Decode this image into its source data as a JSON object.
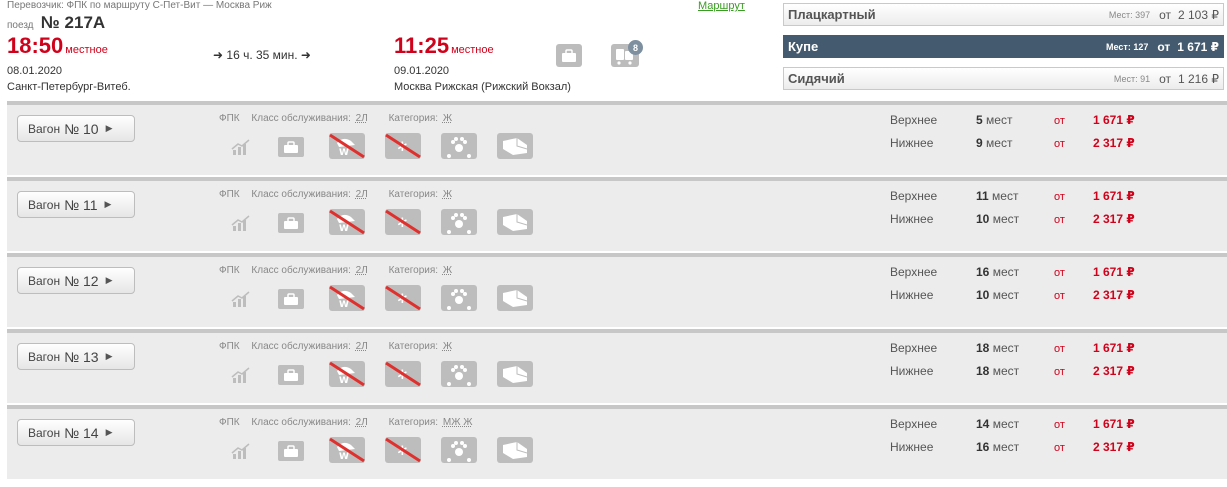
{
  "header": {
    "carrier_text": "Перевозчик: ФПК   по маршруту С-Пет-Вит — Москва Риж",
    "route_link": "Маршрут",
    "train_prefix": "поезд",
    "train_number": "№ 217А",
    "departure": {
      "time": "18:50",
      "local_label": "местное",
      "date": "08.01.2020",
      "station": "Санкт-Петербург-Витеб."
    },
    "duration": "➜ 16 ч. 35 мин. ➜",
    "arrival": {
      "time": "11:25",
      "local_label": "местное",
      "date": "09.01.2020",
      "station": "Москва Рижская (Рижский Вокзал)"
    },
    "icons": [
      "luggage-icon",
      "baggage-cart-icon"
    ],
    "baggage_badge": "8"
  },
  "classes": [
    {
      "name": "Плацкартный",
      "seats": "Мест: 397",
      "from": "от",
      "price": "2 103 ₽",
      "active": false
    },
    {
      "name": "Купе",
      "seats": "Мест: 127",
      "from": "от",
      "price": "1 671 ₽",
      "active": true
    },
    {
      "name": "Сидячий",
      "seats": "Мест: 91",
      "from": "от",
      "price": "1 216 ₽",
      "active": false
    }
  ],
  "wagon_common": {
    "label": "Вагон",
    "carrier": "ФПК",
    "service_label": "Класс обслуживания:",
    "service_class": "2Л",
    "category_label": "Категория:",
    "from": "от",
    "upper_label": "Верхнее",
    "lower_label": "Нижнее",
    "seats_unit": "мест"
  },
  "wagons": [
    {
      "number": "№ 10",
      "category": "Ж",
      "upper_count": "5",
      "upper_price": "1 671 ₽",
      "lower_count": "9",
      "lower_price": "2 317 ₽"
    },
    {
      "number": "№ 11",
      "category": "Ж",
      "upper_count": "11",
      "upper_price": "1 671 ₽",
      "lower_count": "10",
      "lower_price": "2 317 ₽"
    },
    {
      "number": "№ 12",
      "category": "Ж",
      "upper_count": "16",
      "upper_price": "1 671 ₽",
      "lower_count": "10",
      "lower_price": "2 317 ₽"
    },
    {
      "number": "№ 13",
      "category": "Ж",
      "upper_count": "18",
      "upper_price": "1 671 ₽",
      "lower_count": "18",
      "lower_price": "2 317 ₽"
    },
    {
      "number": "№ 14",
      "category": "МЖ Ж",
      "upper_count": "14",
      "upper_price": "1 671 ₽",
      "lower_count": "16",
      "lower_price": "2 317 ₽"
    }
  ],
  "wagon_icons": [
    "chart-icon",
    "luggage-icon",
    "dry-closet-disabled-icon",
    "air-conditioning-disabled-icon",
    "pet-icon",
    "bedding-icon"
  ],
  "colors": {
    "accent_red": "#d0021b",
    "active_class": "#445a6e",
    "route_link": "#3a9d23",
    "icon_gray": "#bdbdbd",
    "strike_red": "#e0302d"
  }
}
